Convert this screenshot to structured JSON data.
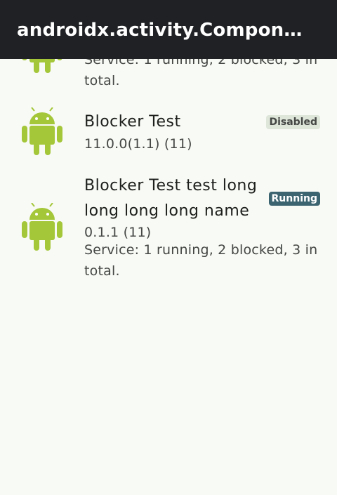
{
  "app_bar": {
    "title": "androidx.activity.Component…"
  },
  "apps": [
    {
      "name": "",
      "version": "",
      "service_line1": "Service: 1 running, 2 blocked, 3 in",
      "service_line2": "total."
    },
    {
      "name": "Blocker Test",
      "version": "11.0.0(1.1) (11)",
      "badge": "Disabled"
    },
    {
      "name_line1": "Blocker Test test long",
      "name_line2": "long long long name",
      "version": "0.1.1 (11)",
      "service_line1": "Service: 1 running, 2 blocked, 3 in",
      "service_line2": "total.",
      "badge": "Running"
    }
  ],
  "colors": {
    "android_green": "#a4c639",
    "app_bar": "#1f2124",
    "background": "#f8faf5",
    "badge_running": "#3c6470",
    "badge_disabled": "#dee5d9"
  },
  "icons": {
    "app_icon": "android-robot-icon"
  }
}
